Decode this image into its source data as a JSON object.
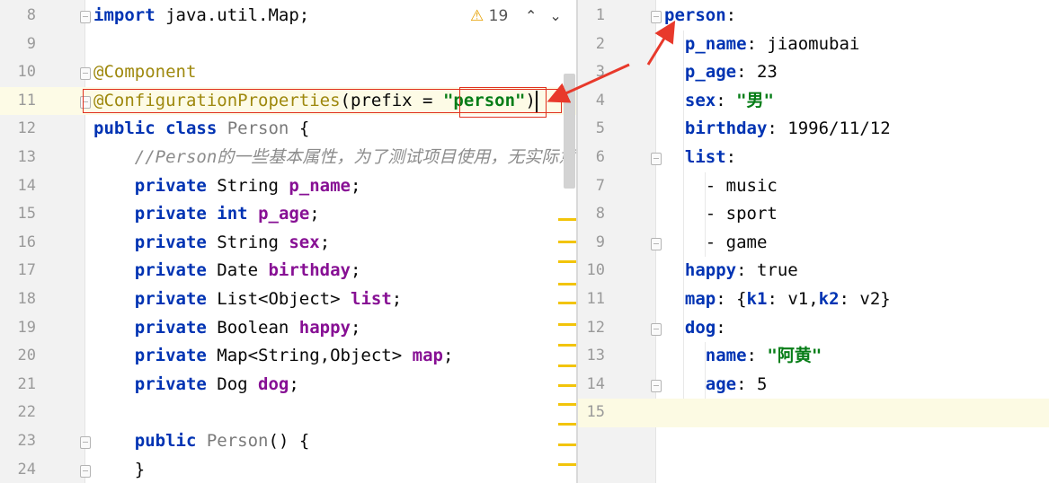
{
  "left_editor": {
    "inspection": {
      "icon": "warning-icon",
      "count": "19"
    },
    "navigation": {
      "up": "up-chevron-icon",
      "down": "down-chevron-icon"
    },
    "lines": [
      {
        "num": "8",
        "tokens": [
          {
            "c": "kw",
            "t": "import"
          },
          {
            "c": "",
            "t": " java.util.Map;"
          }
        ]
      },
      {
        "num": "9",
        "tokens": []
      },
      {
        "num": "10",
        "tokens": [
          {
            "c": "ann",
            "t": "@Component"
          }
        ]
      },
      {
        "num": "11",
        "tokens": [
          {
            "c": "ann",
            "t": "@ConfigurationProperties"
          },
          {
            "c": "",
            "t": "(prefix = "
          },
          {
            "c": "str",
            "t": "\"person\""
          },
          {
            "c": "",
            "t": ")"
          }
        ]
      },
      {
        "num": "12",
        "tokens": [
          {
            "c": "kw",
            "t": "public class"
          },
          {
            "c": "",
            "t": " "
          },
          {
            "c": "cls",
            "t": "Person"
          },
          {
            "c": "",
            "t": " {"
          }
        ]
      },
      {
        "num": "13",
        "tokens": [
          {
            "c": "",
            "t": "    "
          },
          {
            "c": "cmt",
            "t": "//Person的一些基本属性，为了测试项目使用，无实际意"
          }
        ]
      },
      {
        "num": "14",
        "tokens": [
          {
            "c": "",
            "t": "    "
          },
          {
            "c": "kw",
            "t": "private"
          },
          {
            "c": "",
            "t": " String "
          },
          {
            "c": "fld",
            "t": "p_name"
          },
          {
            "c": "",
            "t": ";"
          }
        ]
      },
      {
        "num": "15",
        "tokens": [
          {
            "c": "",
            "t": "    "
          },
          {
            "c": "kw",
            "t": "private int"
          },
          {
            "c": "",
            "t": " "
          },
          {
            "c": "fld",
            "t": "p_age"
          },
          {
            "c": "",
            "t": ";"
          }
        ]
      },
      {
        "num": "16",
        "tokens": [
          {
            "c": "",
            "t": "    "
          },
          {
            "c": "kw",
            "t": "private"
          },
          {
            "c": "",
            "t": " String "
          },
          {
            "c": "fld",
            "t": "sex"
          },
          {
            "c": "",
            "t": ";"
          }
        ]
      },
      {
        "num": "17",
        "tokens": [
          {
            "c": "",
            "t": "    "
          },
          {
            "c": "kw",
            "t": "private"
          },
          {
            "c": "",
            "t": " Date "
          },
          {
            "c": "fld",
            "t": "birthday"
          },
          {
            "c": "",
            "t": ";"
          }
        ]
      },
      {
        "num": "18",
        "tokens": [
          {
            "c": "",
            "t": "    "
          },
          {
            "c": "kw",
            "t": "private"
          },
          {
            "c": "",
            "t": " List<Object> "
          },
          {
            "c": "fld",
            "t": "list"
          },
          {
            "c": "",
            "t": ";"
          }
        ]
      },
      {
        "num": "19",
        "tokens": [
          {
            "c": "",
            "t": "    "
          },
          {
            "c": "kw",
            "t": "private"
          },
          {
            "c": "",
            "t": " Boolean "
          },
          {
            "c": "fld",
            "t": "happy"
          },
          {
            "c": "",
            "t": ";"
          }
        ]
      },
      {
        "num": "20",
        "tokens": [
          {
            "c": "",
            "t": "    "
          },
          {
            "c": "kw",
            "t": "private"
          },
          {
            "c": "",
            "t": " Map<String,Object> "
          },
          {
            "c": "fld",
            "t": "map"
          },
          {
            "c": "",
            "t": ";"
          }
        ]
      },
      {
        "num": "21",
        "tokens": [
          {
            "c": "",
            "t": "    "
          },
          {
            "c": "kw",
            "t": "private"
          },
          {
            "c": "",
            "t": " Dog "
          },
          {
            "c": "fld",
            "t": "dog"
          },
          {
            "c": "",
            "t": ";"
          }
        ]
      },
      {
        "num": "22",
        "tokens": []
      },
      {
        "num": "23",
        "tokens": [
          {
            "c": "",
            "t": "    "
          },
          {
            "c": "kw",
            "t": "public"
          },
          {
            "c": "",
            "t": " "
          },
          {
            "c": "cls",
            "t": "Person"
          },
          {
            "c": "",
            "t": "() {"
          }
        ]
      },
      {
        "num": "24",
        "tokens": [
          {
            "c": "",
            "t": "    }"
          }
        ]
      }
    ]
  },
  "right_editor": {
    "lines": [
      {
        "num": "1",
        "tokens": [
          {
            "c": "ykey",
            "t": "person"
          },
          {
            "c": "",
            "t": ":"
          }
        ]
      },
      {
        "num": "2",
        "tokens": [
          {
            "c": "",
            "t": "  "
          },
          {
            "c": "ykey",
            "t": "p_name"
          },
          {
            "c": "",
            "t": ": jiaomubai"
          }
        ]
      },
      {
        "num": "3",
        "tokens": [
          {
            "c": "",
            "t": "  "
          },
          {
            "c": "ykey",
            "t": "p_age"
          },
          {
            "c": "",
            "t": ": 23"
          }
        ]
      },
      {
        "num": "4",
        "tokens": [
          {
            "c": "",
            "t": "  "
          },
          {
            "c": "ykey",
            "t": "sex"
          },
          {
            "c": "",
            "t": ": "
          },
          {
            "c": "str",
            "t": "\"男\""
          }
        ]
      },
      {
        "num": "5",
        "tokens": [
          {
            "c": "",
            "t": "  "
          },
          {
            "c": "ykey",
            "t": "birthday"
          },
          {
            "c": "",
            "t": ": 1996/11/12"
          }
        ]
      },
      {
        "num": "6",
        "tokens": [
          {
            "c": "",
            "t": "  "
          },
          {
            "c": "ykey",
            "t": "list"
          },
          {
            "c": "",
            "t": ":"
          }
        ]
      },
      {
        "num": "7",
        "tokens": [
          {
            "c": "",
            "t": "    - music"
          }
        ]
      },
      {
        "num": "8",
        "tokens": [
          {
            "c": "",
            "t": "    - sport"
          }
        ]
      },
      {
        "num": "9",
        "tokens": [
          {
            "c": "",
            "t": "    - game"
          }
        ]
      },
      {
        "num": "10",
        "tokens": [
          {
            "c": "",
            "t": "  "
          },
          {
            "c": "ykey",
            "t": "happy"
          },
          {
            "c": "",
            "t": ": true"
          }
        ]
      },
      {
        "num": "11",
        "tokens": [
          {
            "c": "",
            "t": "  "
          },
          {
            "c": "ykey",
            "t": "map"
          },
          {
            "c": "",
            "t": ": {"
          },
          {
            "c": "ykey",
            "t": "k1"
          },
          {
            "c": "",
            "t": ": v1,"
          },
          {
            "c": "ykey",
            "t": "k2"
          },
          {
            "c": "",
            "t": ": v2}"
          }
        ]
      },
      {
        "num": "12",
        "tokens": [
          {
            "c": "",
            "t": "  "
          },
          {
            "c": "ykey",
            "t": "dog"
          },
          {
            "c": "",
            "t": ":"
          }
        ]
      },
      {
        "num": "13",
        "tokens": [
          {
            "c": "",
            "t": "    "
          },
          {
            "c": "ykey",
            "t": "name"
          },
          {
            "c": "",
            "t": ": "
          },
          {
            "c": "str",
            "t": "\"阿黄\""
          }
        ]
      },
      {
        "num": "14",
        "tokens": [
          {
            "c": "",
            "t": "    "
          },
          {
            "c": "ykey",
            "t": "age"
          },
          {
            "c": "",
            "t": ": 5"
          }
        ]
      },
      {
        "num": "15",
        "tokens": []
      }
    ]
  },
  "colors": {
    "annotation_box": "#e0311e",
    "keyword": "#0033b3",
    "string": "#067d17",
    "field": "#871094",
    "warning_marker": "#f2c40a"
  }
}
